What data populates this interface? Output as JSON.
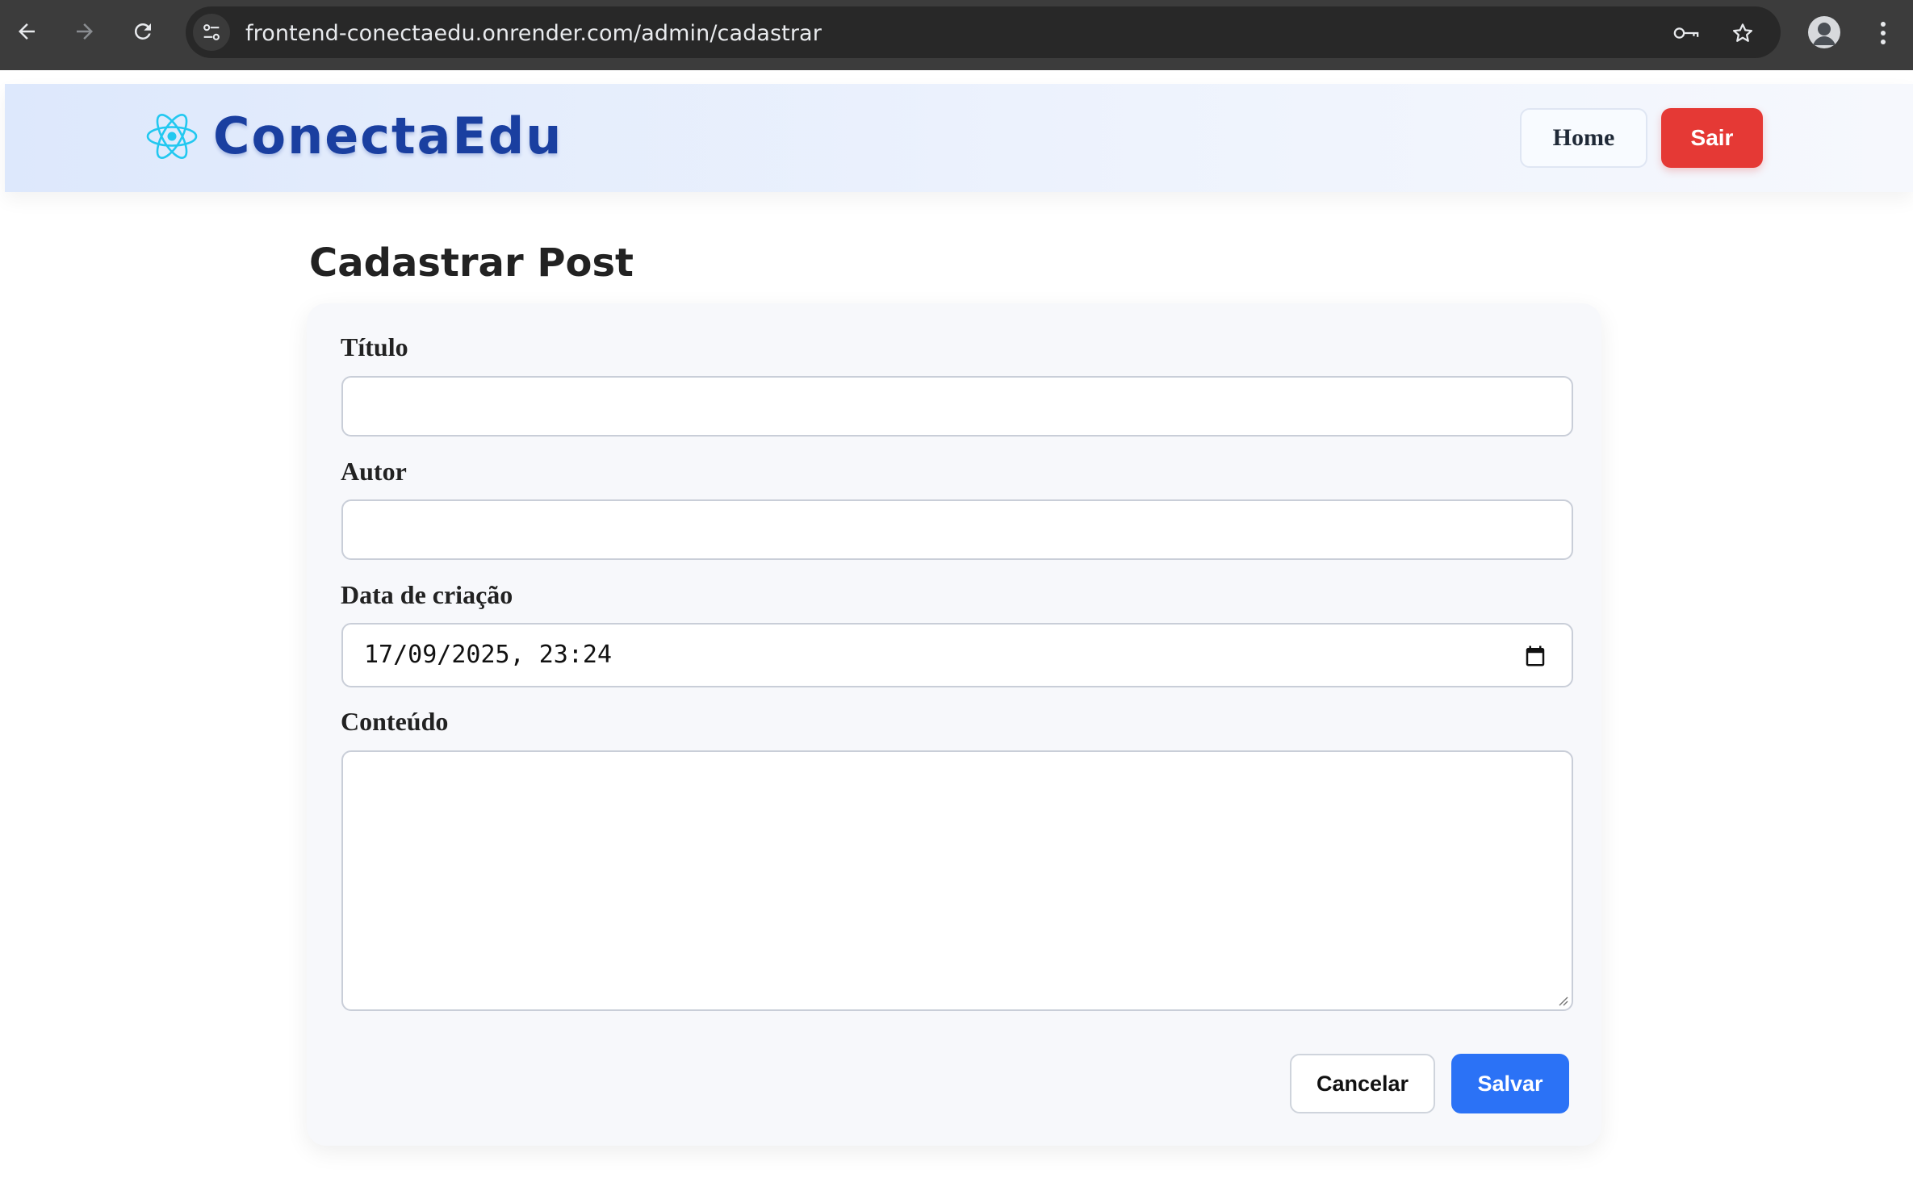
{
  "browser": {
    "url": "frontend-conectaedu.onrender.com/admin/cadastrar",
    "icons": {
      "back": "arrow-left-icon",
      "forward": "arrow-right-icon",
      "reload": "reload-icon",
      "site_info": "tune-icon",
      "password": "key-icon",
      "bookmark": "star-icon",
      "profile": "avatar",
      "menu": "more-vert-icon"
    }
  },
  "header": {
    "brand_name": "ConectaEdu",
    "brand_icon": "atom-icon",
    "home_label": "Home",
    "logout_label": "Sair"
  },
  "page": {
    "title": "Cadastrar Post"
  },
  "form": {
    "title_label": "Título",
    "title_value": "",
    "author_label": "Autor",
    "author_value": "",
    "date_label": "Data de criação",
    "date_value": "17/09/2025, 23:24",
    "content_label": "Conteúdo",
    "content_value": "",
    "cancel_label": "Cancelar",
    "save_label": "Salvar"
  },
  "colors": {
    "brand": "#1a3fa0",
    "logout": "#e53935",
    "save": "#2b72f6",
    "atom": "#22c8f0"
  }
}
